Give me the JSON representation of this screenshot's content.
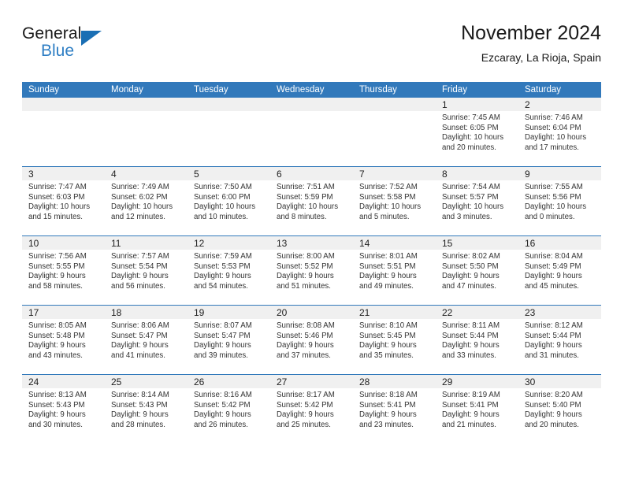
{
  "brand": {
    "name_part1": "General",
    "name_part2": "Blue",
    "accent_color": "#1a6fb4"
  },
  "header": {
    "title": "November 2024",
    "subtitle": "Ezcaray, La Rioja, Spain"
  },
  "theme": {
    "header_blue": "#3279bb",
    "daynum_band": "#f0f0f0",
    "text": "#333333"
  },
  "weekdays": [
    "Sunday",
    "Monday",
    "Tuesday",
    "Wednesday",
    "Thursday",
    "Friday",
    "Saturday"
  ],
  "weeks": [
    [
      {
        "day": ""
      },
      {
        "day": ""
      },
      {
        "day": ""
      },
      {
        "day": ""
      },
      {
        "day": ""
      },
      {
        "day": "1",
        "sunrise": "Sunrise: 7:45 AM",
        "sunset": "Sunset: 6:05 PM",
        "daylight1": "Daylight: 10 hours",
        "daylight2": "and 20 minutes."
      },
      {
        "day": "2",
        "sunrise": "Sunrise: 7:46 AM",
        "sunset": "Sunset: 6:04 PM",
        "daylight1": "Daylight: 10 hours",
        "daylight2": "and 17 minutes."
      }
    ],
    [
      {
        "day": "3",
        "sunrise": "Sunrise: 7:47 AM",
        "sunset": "Sunset: 6:03 PM",
        "daylight1": "Daylight: 10 hours",
        "daylight2": "and 15 minutes."
      },
      {
        "day": "4",
        "sunrise": "Sunrise: 7:49 AM",
        "sunset": "Sunset: 6:02 PM",
        "daylight1": "Daylight: 10 hours",
        "daylight2": "and 12 minutes."
      },
      {
        "day": "5",
        "sunrise": "Sunrise: 7:50 AM",
        "sunset": "Sunset: 6:00 PM",
        "daylight1": "Daylight: 10 hours",
        "daylight2": "and 10 minutes."
      },
      {
        "day": "6",
        "sunrise": "Sunrise: 7:51 AM",
        "sunset": "Sunset: 5:59 PM",
        "daylight1": "Daylight: 10 hours",
        "daylight2": "and 8 minutes."
      },
      {
        "day": "7",
        "sunrise": "Sunrise: 7:52 AM",
        "sunset": "Sunset: 5:58 PM",
        "daylight1": "Daylight: 10 hours",
        "daylight2": "and 5 minutes."
      },
      {
        "day": "8",
        "sunrise": "Sunrise: 7:54 AM",
        "sunset": "Sunset: 5:57 PM",
        "daylight1": "Daylight: 10 hours",
        "daylight2": "and 3 minutes."
      },
      {
        "day": "9",
        "sunrise": "Sunrise: 7:55 AM",
        "sunset": "Sunset: 5:56 PM",
        "daylight1": "Daylight: 10 hours",
        "daylight2": "and 0 minutes."
      }
    ],
    [
      {
        "day": "10",
        "sunrise": "Sunrise: 7:56 AM",
        "sunset": "Sunset: 5:55 PM",
        "daylight1": "Daylight: 9 hours",
        "daylight2": "and 58 minutes."
      },
      {
        "day": "11",
        "sunrise": "Sunrise: 7:57 AM",
        "sunset": "Sunset: 5:54 PM",
        "daylight1": "Daylight: 9 hours",
        "daylight2": "and 56 minutes."
      },
      {
        "day": "12",
        "sunrise": "Sunrise: 7:59 AM",
        "sunset": "Sunset: 5:53 PM",
        "daylight1": "Daylight: 9 hours",
        "daylight2": "and 54 minutes."
      },
      {
        "day": "13",
        "sunrise": "Sunrise: 8:00 AM",
        "sunset": "Sunset: 5:52 PM",
        "daylight1": "Daylight: 9 hours",
        "daylight2": "and 51 minutes."
      },
      {
        "day": "14",
        "sunrise": "Sunrise: 8:01 AM",
        "sunset": "Sunset: 5:51 PM",
        "daylight1": "Daylight: 9 hours",
        "daylight2": "and 49 minutes."
      },
      {
        "day": "15",
        "sunrise": "Sunrise: 8:02 AM",
        "sunset": "Sunset: 5:50 PM",
        "daylight1": "Daylight: 9 hours",
        "daylight2": "and 47 minutes."
      },
      {
        "day": "16",
        "sunrise": "Sunrise: 8:04 AM",
        "sunset": "Sunset: 5:49 PM",
        "daylight1": "Daylight: 9 hours",
        "daylight2": "and 45 minutes."
      }
    ],
    [
      {
        "day": "17",
        "sunrise": "Sunrise: 8:05 AM",
        "sunset": "Sunset: 5:48 PM",
        "daylight1": "Daylight: 9 hours",
        "daylight2": "and 43 minutes."
      },
      {
        "day": "18",
        "sunrise": "Sunrise: 8:06 AM",
        "sunset": "Sunset: 5:47 PM",
        "daylight1": "Daylight: 9 hours",
        "daylight2": "and 41 minutes."
      },
      {
        "day": "19",
        "sunrise": "Sunrise: 8:07 AM",
        "sunset": "Sunset: 5:47 PM",
        "daylight1": "Daylight: 9 hours",
        "daylight2": "and 39 minutes."
      },
      {
        "day": "20",
        "sunrise": "Sunrise: 8:08 AM",
        "sunset": "Sunset: 5:46 PM",
        "daylight1": "Daylight: 9 hours",
        "daylight2": "and 37 minutes."
      },
      {
        "day": "21",
        "sunrise": "Sunrise: 8:10 AM",
        "sunset": "Sunset: 5:45 PM",
        "daylight1": "Daylight: 9 hours",
        "daylight2": "and 35 minutes."
      },
      {
        "day": "22",
        "sunrise": "Sunrise: 8:11 AM",
        "sunset": "Sunset: 5:44 PM",
        "daylight1": "Daylight: 9 hours",
        "daylight2": "and 33 minutes."
      },
      {
        "day": "23",
        "sunrise": "Sunrise: 8:12 AM",
        "sunset": "Sunset: 5:44 PM",
        "daylight1": "Daylight: 9 hours",
        "daylight2": "and 31 minutes."
      }
    ],
    [
      {
        "day": "24",
        "sunrise": "Sunrise: 8:13 AM",
        "sunset": "Sunset: 5:43 PM",
        "daylight1": "Daylight: 9 hours",
        "daylight2": "and 30 minutes."
      },
      {
        "day": "25",
        "sunrise": "Sunrise: 8:14 AM",
        "sunset": "Sunset: 5:43 PM",
        "daylight1": "Daylight: 9 hours",
        "daylight2": "and 28 minutes."
      },
      {
        "day": "26",
        "sunrise": "Sunrise: 8:16 AM",
        "sunset": "Sunset: 5:42 PM",
        "daylight1": "Daylight: 9 hours",
        "daylight2": "and 26 minutes."
      },
      {
        "day": "27",
        "sunrise": "Sunrise: 8:17 AM",
        "sunset": "Sunset: 5:42 PM",
        "daylight1": "Daylight: 9 hours",
        "daylight2": "and 25 minutes."
      },
      {
        "day": "28",
        "sunrise": "Sunrise: 8:18 AM",
        "sunset": "Sunset: 5:41 PM",
        "daylight1": "Daylight: 9 hours",
        "daylight2": "and 23 minutes."
      },
      {
        "day": "29",
        "sunrise": "Sunrise: 8:19 AM",
        "sunset": "Sunset: 5:41 PM",
        "daylight1": "Daylight: 9 hours",
        "daylight2": "and 21 minutes."
      },
      {
        "day": "30",
        "sunrise": "Sunrise: 8:20 AM",
        "sunset": "Sunset: 5:40 PM",
        "daylight1": "Daylight: 9 hours",
        "daylight2": "and 20 minutes."
      }
    ]
  ]
}
